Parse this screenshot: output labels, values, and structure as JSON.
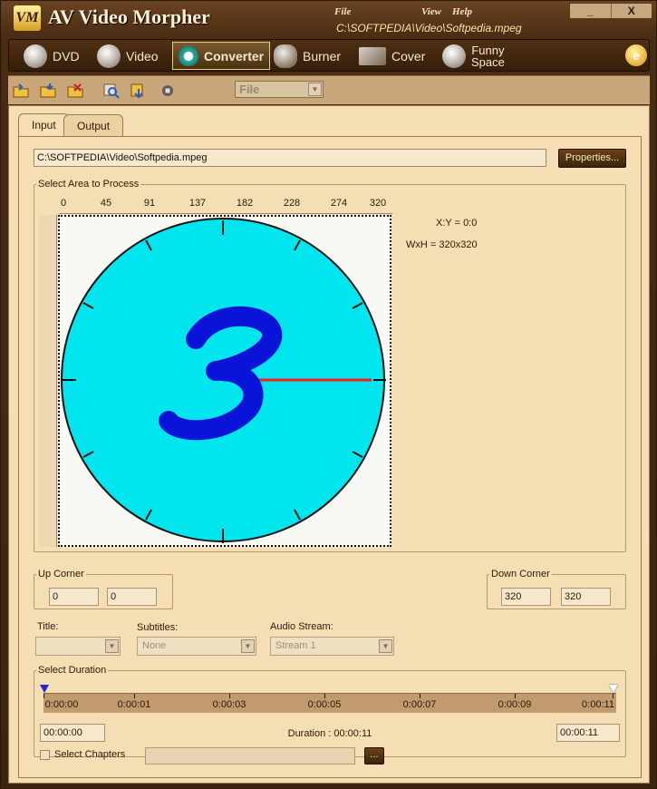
{
  "title_bar": {
    "logo_text": "VM",
    "app_title": "AV Video Morpher",
    "menu": [
      "File",
      "View",
      "Help"
    ],
    "file_path": "C:\\SOFTPEDIA\\Video\\Softpedia.mpeg",
    "minimize_label": "_",
    "close_label": "X"
  },
  "nav_tabs": [
    {
      "label": "DVD",
      "icon": "dvd-disc-icon"
    },
    {
      "label": "Video",
      "icon": "video-disc-icon"
    },
    {
      "label": "Converter",
      "icon": "converter-icon"
    },
    {
      "label": "Burner",
      "icon": "burner-icon"
    },
    {
      "label": "Cover",
      "icon": "cover-icon"
    },
    {
      "label": "Funny",
      "label2": "Space",
      "icon": "funny-space-icon"
    }
  ],
  "active_nav": "Converter",
  "help_icon_label": "e",
  "toolbar": {
    "icons": [
      "open-folder-icon",
      "save-icon",
      "clear-icon",
      "zoom-icon",
      "export-icon",
      "stop-icon"
    ],
    "file_combo": "File"
  },
  "subtabs": [
    "Input",
    "Output"
  ],
  "active_subtab": "Input",
  "input": {
    "path": "C:\\SOFTPEDIA\\Video\\Softpedia.mpeg",
    "properties_label": "Properties..."
  },
  "select_area": {
    "legend": "Select Area to Process",
    "ruler_ticks": [
      "0",
      "45",
      "91",
      "137",
      "182",
      "228",
      "274",
      "320"
    ],
    "xy_text": "X:Y = 0:0",
    "wh_text": "WxH = 320x320",
    "preview_digit": "3"
  },
  "up_corner": {
    "legend": "Up Corner",
    "x": "0",
    "y": "0"
  },
  "down_corner": {
    "legend": "Down Corner",
    "x": "320",
    "y": "320"
  },
  "streams": {
    "title_label": "Title:",
    "title_value": "",
    "subtitles_label": "Subtitles:",
    "subtitles_value": "None",
    "audio_label": "Audio Stream:",
    "audio_value": "Stream  1"
  },
  "duration": {
    "legend": "Select Duration",
    "timeline_labels": [
      "0:00:00",
      "0:00:01",
      "0:00:03",
      "0:00:05",
      "0:00:07",
      "0:00:09",
      "0:00:11"
    ],
    "start_time": "00:00:00",
    "end_time": "00:00:11",
    "duration_text": "Duration : 00:00:11",
    "chapters_label": "Select Chapters",
    "dots_label": "..."
  },
  "colors": {
    "accent_dark": "#3e2408",
    "panel": "#f5deb3",
    "preview_fill": "#00e5ee",
    "preview_digit": "#0a14d8",
    "preview_hand": "#ff1a1a"
  }
}
